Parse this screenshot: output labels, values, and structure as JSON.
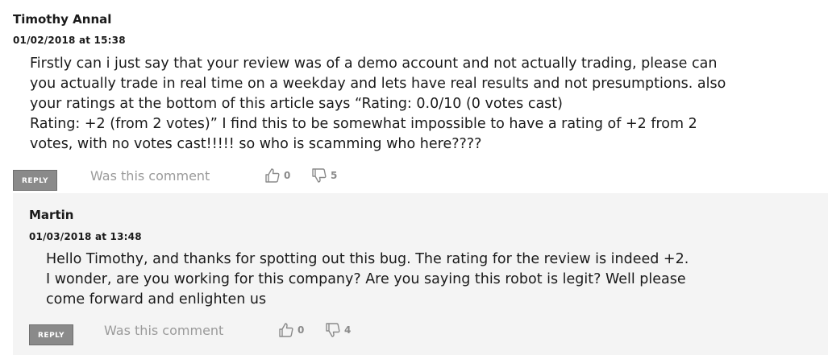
{
  "comments": [
    {
      "author": "Timothy Annal",
      "date": "01/02/2018 at 15:38",
      "lines": [
        "Firstly can i just say that your review was of a demo account and not actually trading, please can",
        "you actually trade in real time on a weekday and lets have real results and not presumptions. also",
        "your ratings at the bottom of this article says “Rating: 0.0/10 (0 votes cast)",
        "Rating: +2 (from 2 votes)” I find this to be somewhat impossible to have a rating of +2 from 2",
        "votes, with no votes cast!!!!! so who is scamming who here????"
      ],
      "reply_label": "REPLY",
      "was_this_comment": "Was this comment",
      "likes": "0",
      "dislikes": "5"
    },
    {
      "author": "Martin",
      "date": "01/03/2018 at 13:48",
      "lines": [
        "Hello Timothy, and thanks for spotting out this bug. The rating for the review is indeed +2.",
        "I wonder, are you working for this company? Are you saying this robot is legit? Well please",
        "come forward and enlighten us"
      ],
      "reply_label": "REPLY",
      "was_this_comment": "Was this comment",
      "likes": "0",
      "dislikes": "4"
    }
  ],
  "icons": {
    "like": "thumbs-up-icon",
    "dislike": "thumbs-down-icon"
  },
  "colors": {
    "reply_button": "#8a8a8a",
    "reply_background": "#f4f4f4",
    "muted_text": "#9a9a9a"
  }
}
